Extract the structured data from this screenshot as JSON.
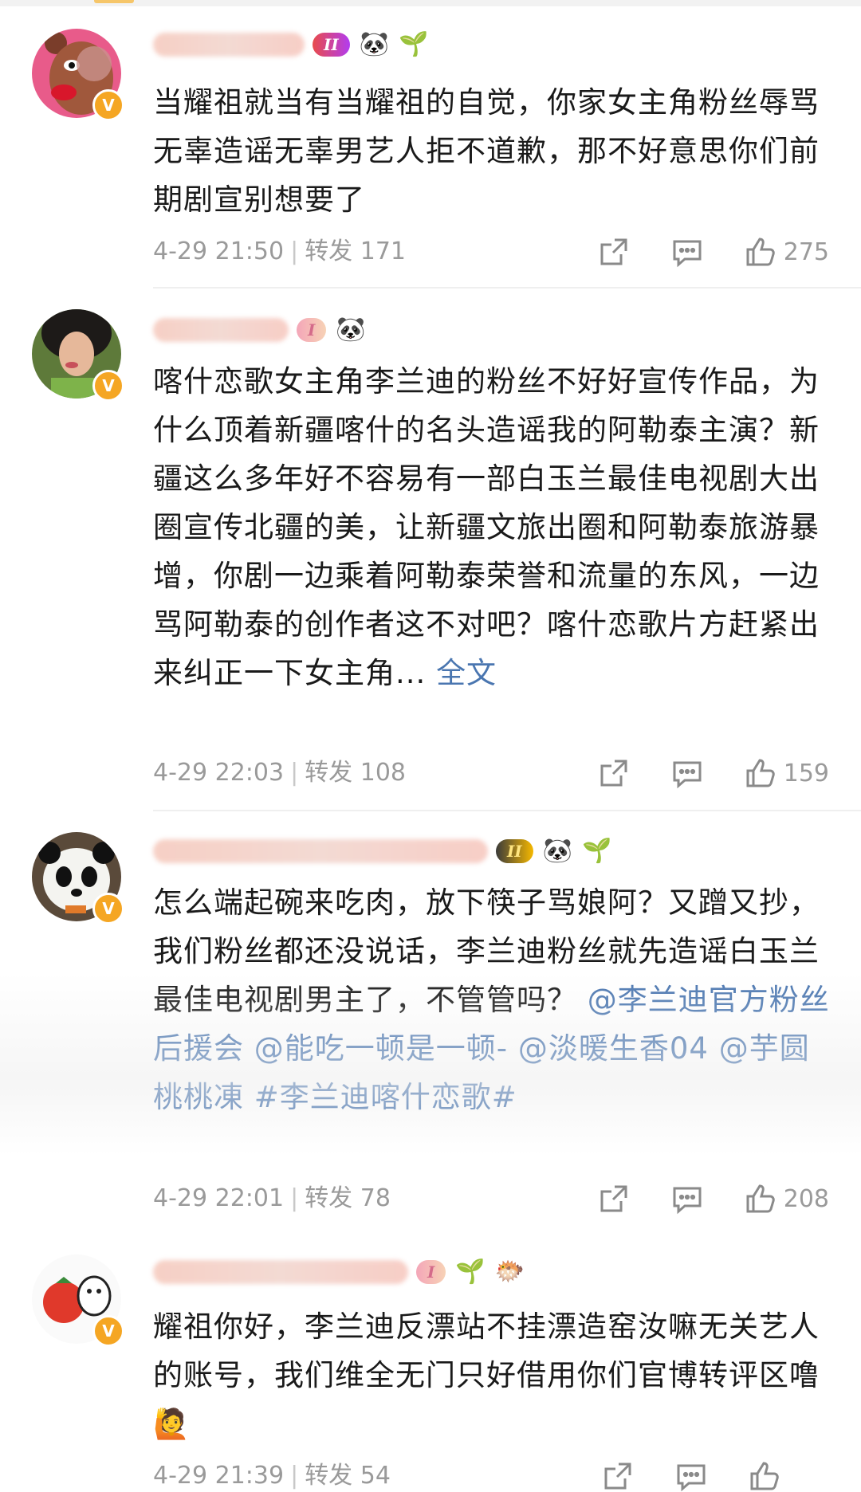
{
  "comments": [
    {
      "level": "II",
      "emojis": [
        "🐼",
        "🌱"
      ],
      "text": "当耀祖就当有当耀祖的自觉，你家女主角粉丝辱骂无辜造谣无辜男艺人拒不道歉，那不好意思你们前期剧宣别想要了",
      "time": "4-29 21:50",
      "repost_label": "转发",
      "reposts": "171",
      "likes": "275",
      "verified": "V"
    },
    {
      "level": "I",
      "emojis": [
        "🐼"
      ],
      "text": "喀什恋歌女主角李兰迪的粉丝不好好宣传作品，为什么顶着新疆喀什的名头造谣我的阿勒泰主演？新疆这么多年好不容易有一部白玉兰最佳电视剧大出圈宣传北疆的美，让新疆文旅出圈和阿勒泰旅游暴增，你剧一边乘着阿勒泰荣誉和流量的东风，一边骂阿勒泰的创作者这不对吧？喀什恋歌片方赶紧出来纠正一下女主角...",
      "full_text_link": "全文",
      "time": "4-29 22:03",
      "repost_label": "转发",
      "reposts": "108",
      "likes": "159",
      "verified": "V"
    },
    {
      "level": "II",
      "emojis": [
        "🐼",
        "🌱"
      ],
      "text_plain": "怎么端起碗来吃肉，放下筷子骂娘阿？又蹭又抄，我们粉丝都还没说话，李兰迪粉丝就先造谣白玉兰最佳电视剧男主了，不管管吗？",
      "mentions": "@李兰迪官方粉丝后援会 @能吃一顿是一顿- @淡暖生香04 @芋圆桃桃凍 #李兰迪喀什恋歌#",
      "time": "4-29 22:01",
      "repost_label": "转发",
      "reposts": "78",
      "likes": "208",
      "verified": "V"
    },
    {
      "level": "I",
      "emojis": [
        "🌱",
        "🐡"
      ],
      "text": "耀祖你好，李兰迪反漂站不挂漂造窑汝嘛无关艺人的账号，我们维全无门只好借用你们官博转评区噜",
      "trailing_emoji": "🙋",
      "time": "4-29 21:39",
      "repost_label": "转发",
      "reposts": "54",
      "verified": "V"
    }
  ],
  "icons": {
    "share": "share-icon",
    "comment": "comment-icon",
    "like": "thumbs-up-icon"
  },
  "colors": {
    "link_blue": "#4a76b0",
    "verified_orange": "#f5a623",
    "meta_gray": "#9a9a9a"
  }
}
